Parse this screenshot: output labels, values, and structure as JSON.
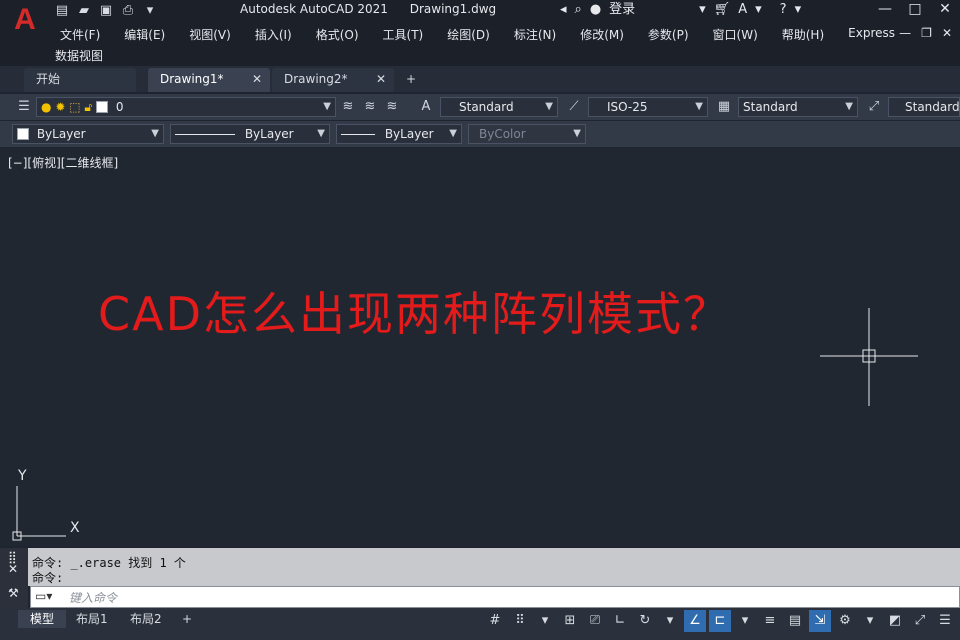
{
  "app": {
    "name": "Autodesk AutoCAD 2021",
    "file": "Drawing1.dwg",
    "login": "登录"
  },
  "menus": [
    "文件(F)",
    "编辑(E)",
    "视图(V)",
    "插入(I)",
    "格式(O)",
    "工具(T)",
    "绘图(D)",
    "标注(N)",
    "修改(M)",
    "参数(P)",
    "窗口(W)",
    "帮助(H)",
    "Express"
  ],
  "menu_row2": "数据视图",
  "tabs": [
    {
      "label": "开始"
    },
    {
      "label": "Drawing1*"
    },
    {
      "label": "Drawing2*"
    }
  ],
  "toolbar": {
    "layer": "0",
    "text_style": "Standard",
    "dim_style": "ISO-25",
    "table_style": "Standard",
    "mleader_style": "Standard",
    "color": "ByLayer",
    "linetype": "ByLayer",
    "lineweight": "ByLayer",
    "plotstyle": "ByColor"
  },
  "canvas": {
    "view_label": "[−][俯视][二维线框]",
    "overlay_text": "CAD怎么出现两种阵列模式？",
    "overlay_color": "#e41b1b",
    "ucs_x": "X",
    "ucs_y": "Y"
  },
  "command": {
    "history": [
      "命令: _.erase 找到 1 个",
      "命令:"
    ],
    "placeholder": "键入命令"
  },
  "layouts": [
    "模型",
    "布局1",
    "布局2"
  ]
}
